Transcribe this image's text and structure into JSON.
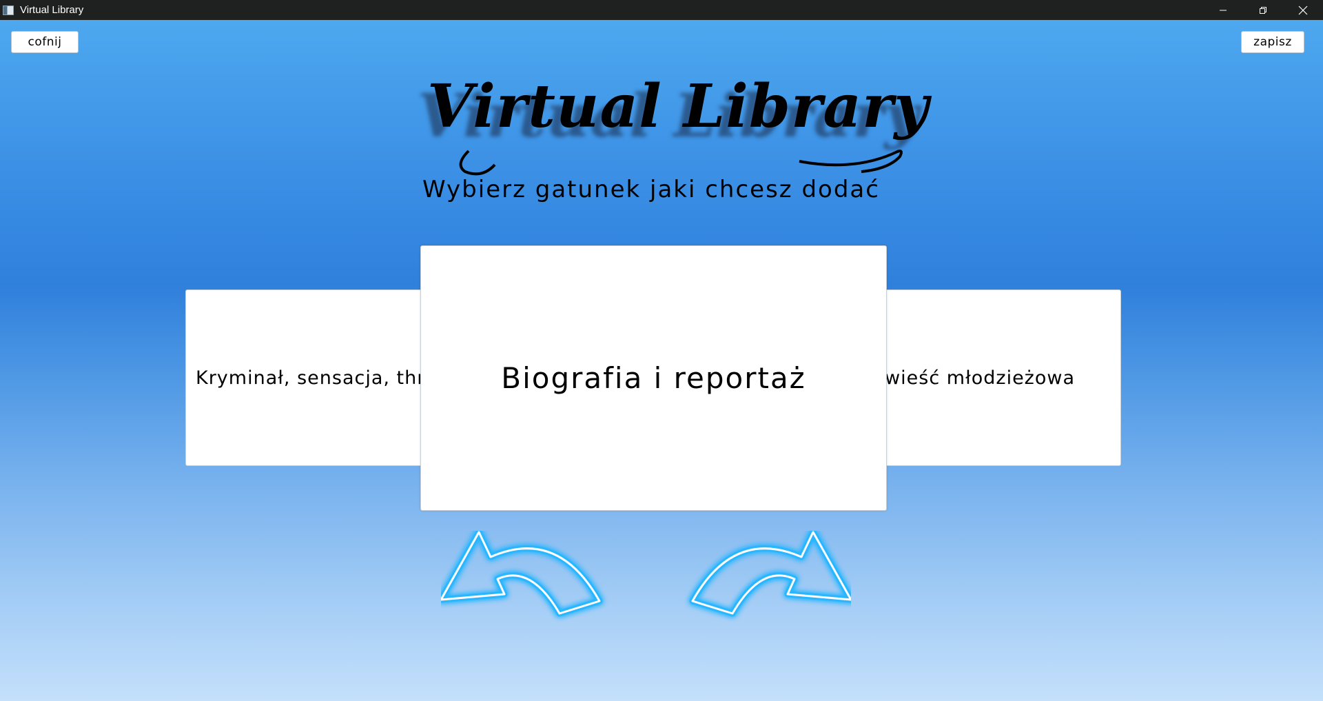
{
  "window": {
    "title": "Virtual Library",
    "controls": [
      "minimize-icon",
      "restore-icon",
      "close-icon"
    ]
  },
  "toolbar": {
    "back_label": "cofnij",
    "save_label": "zapisz"
  },
  "header": {
    "logo_text": "Virtual Library",
    "subtitle": "Wybierz gatunek jaki chcesz dodać"
  },
  "carousel": {
    "prev_card": "Kryminał, sensacja, thriller",
    "current_card": "Biografia i reportaż",
    "next_card": "Powieść młodzieżowa",
    "prev_icon": "rotate-left-arrow-icon",
    "next_icon": "rotate-right-arrow-icon"
  },
  "colors": {
    "titlebar": "#1e211f",
    "background_top": "#4ea8ef",
    "background_mid": "#2f80dc",
    "background_bottom": "#c4e0fb",
    "arrow_glow": "#29b6ff",
    "card": "#ffffff"
  }
}
